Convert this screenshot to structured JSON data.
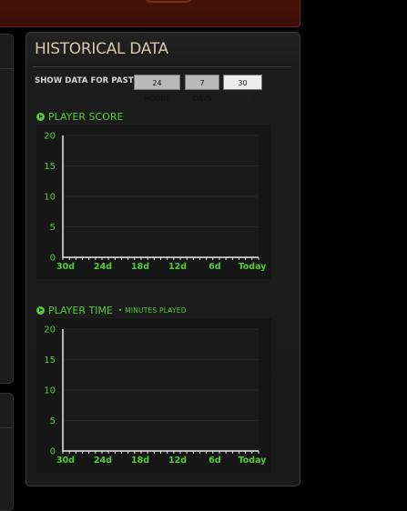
{
  "panel": {
    "title": "HISTORICAL DATA",
    "show_label": "SHOW DATA FOR PAST:",
    "ranges": [
      "24 HOURS",
      "7 DAYS",
      "30 DAYS"
    ],
    "selected_range": "30 DAYS"
  },
  "colors": {
    "accent": "#55cc3a",
    "title": "#d6c8a8",
    "panel": "#1c1c1c"
  },
  "sections": {
    "score": {
      "title": "PLAYER SCORE",
      "icon": "play-circle-icon"
    },
    "time": {
      "title": "PLAYER TIME",
      "subtitle": "• MINUTES PLAYED",
      "icon": "play-circle-icon"
    }
  },
  "chart_data": [
    {
      "type": "line",
      "title": "PLAYER SCORE",
      "x_tick_labels": [
        "30d",
        "24d",
        "18d",
        "12d",
        "6d",
        "Today"
      ],
      "y_ticks": [
        0,
        5,
        10,
        15,
        20
      ],
      "ylim": [
        0,
        20
      ],
      "series": [],
      "grid": true
    },
    {
      "type": "line",
      "title": "PLAYER TIME",
      "subtitle": "• MINUTES PLAYED",
      "x_tick_labels": [
        "30d",
        "24d",
        "18d",
        "12d",
        "6d",
        "Today"
      ],
      "y_ticks": [
        0,
        5,
        10,
        15,
        20
      ],
      "ylim": [
        0,
        20
      ],
      "series": [],
      "grid": true
    }
  ]
}
